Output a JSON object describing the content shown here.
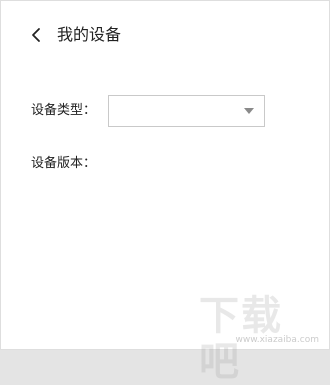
{
  "header": {
    "title": "我的设备",
    "back_icon": "chevron-left-icon"
  },
  "form": {
    "device_type_label": "设备类型：",
    "device_type_value": "",
    "device_version_label": "设备版本：",
    "dropdown_icon": "caret-down-icon"
  },
  "watermark": {
    "text": "下载吧",
    "url": "www.xiazaiba.com"
  }
}
